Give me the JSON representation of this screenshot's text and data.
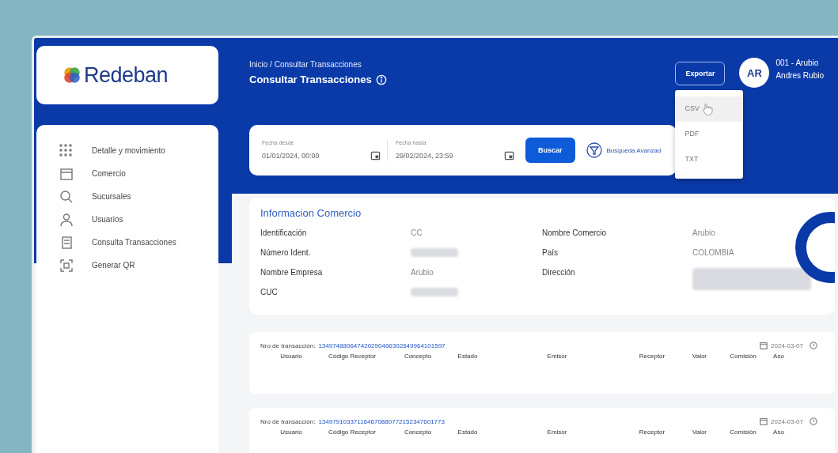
{
  "logo": {
    "text": "Redeban"
  },
  "sidebar": {
    "items": [
      {
        "label": "Detalle y movimiento"
      },
      {
        "label": "Comercio"
      },
      {
        "label": "Sucursales"
      },
      {
        "label": "Usuarios"
      },
      {
        "label": "Consulta Transacciones"
      },
      {
        "label": "Generar QR"
      }
    ]
  },
  "header": {
    "breadcrumb": "Inicio / Consultar Transacciones",
    "title": "Consultar Transacciones"
  },
  "export": {
    "label": "Exportar",
    "expanded": true,
    "options": [
      {
        "label": "CSV",
        "hovered": true
      },
      {
        "label": "PDF",
        "hovered": false
      },
      {
        "label": "TXT",
        "hovered": false
      }
    ]
  },
  "user": {
    "initials": "AR",
    "code": "001 - Arubio",
    "name": "Andres Rubio"
  },
  "filters": {
    "fields": [
      {
        "label": "Fecha desde",
        "value": "01/01/2024, 00:00"
      },
      {
        "label": "Fecha hasta",
        "value": "29/02/2024, 23:59"
      }
    ],
    "search_button": "Buscar",
    "advanced": "Busqueda Avanzad"
  },
  "info": {
    "title": "Informacion Comercio",
    "columns": [
      [
        {
          "label": "Identificación",
          "value": "CC",
          "redacted": false
        },
        {
          "label": "Número Ident.",
          "redacted": true
        },
        {
          "label": "Nombre Empresa",
          "value": "Arubio",
          "redacted": false
        },
        {
          "label": "CUC",
          "redacted": true
        }
      ],
      [
        {
          "label": "Nombre Comercio",
          "value": "Arubio",
          "redacted": false
        },
        {
          "label": "País",
          "value": "COLOMBIA",
          "redacted": false
        },
        {
          "label": "Dirección",
          "redacted": true
        }
      ]
    ]
  },
  "transactions": [
    {
      "label": "Nro de transacción:",
      "number": "134974880647420290466302649964101597",
      "date": "2024-03-07",
      "columns": [
        "Usuario",
        "Código Receptor",
        "Concepto",
        "Estado",
        "Emisor",
        "Receptor",
        "Valor",
        "Comisión",
        "Aso"
      ]
    },
    {
      "label": "Nro de transacción:",
      "number": "134979103371164670880772152347601773",
      "date": "2024-03-07",
      "columns": [
        "Usuario",
        "Código Receptor",
        "Concepto",
        "Estado",
        "Emisor",
        "Receptor",
        "Valor",
        "Comisión",
        "Aso"
      ]
    }
  ]
}
